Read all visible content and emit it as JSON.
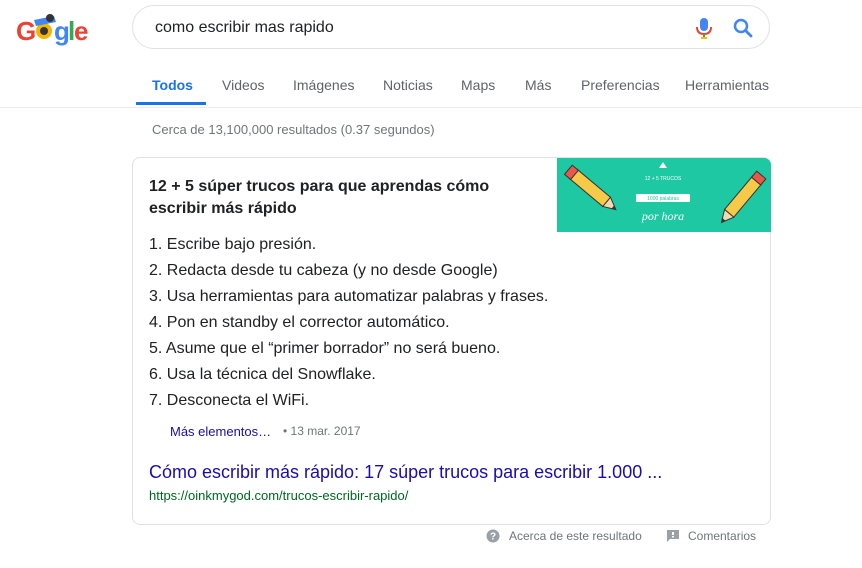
{
  "logo": {
    "text": "Google"
  },
  "search": {
    "query": "como escribir mas rapido"
  },
  "tabs": [
    {
      "label": "Todos"
    },
    {
      "label": "Videos"
    },
    {
      "label": "Imágenes"
    },
    {
      "label": "Noticias"
    },
    {
      "label": "Maps"
    },
    {
      "label": "Más"
    },
    {
      "label": "Preferencias"
    },
    {
      "label": "Herramientas"
    }
  ],
  "stats": "Cerca de 13,100,000 resultados (0.37 segundos)",
  "snippet": {
    "title": "12 + 5 súper trucos para que aprendas cómo escribir más rápido",
    "image_text": {
      "top": "12 + 5 TRUCOS",
      "badge": "1000 palabras",
      "bottom": "por hora"
    },
    "items": [
      "1. Escribe bajo presión.",
      "2. Redacta desde tu cabeza (y no desde Google)",
      "3. Usa herramientas para automatizar palabras y frases.",
      "4. Pon en standby el corrector automático.",
      "5. Asume que el “primer borrador” no será bueno.",
      "6. Usa la técnica del Snowflake.",
      "7. Desconecta el WiFi."
    ],
    "more_label": "Más elementos…",
    "date": "13 mar. 2017",
    "link_title": "Cómo escribir más rápido: 17 súper trucos para escribir 1.000 ...",
    "url": "https://oinkmygod.com/trucos-escribir-rapido/"
  },
  "footer": {
    "about": "Acerca de este resultado",
    "feedback": "Comentarios"
  },
  "colors": {
    "accent": "#1a73e8",
    "link": "#1a0dab",
    "url": "#006621",
    "thumb_bg": "#1ec8a3"
  }
}
